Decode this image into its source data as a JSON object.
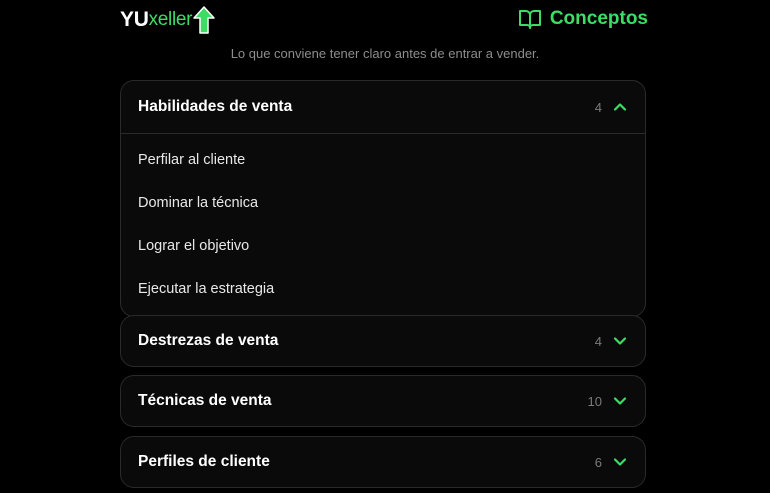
{
  "header": {
    "logo_yu": "YU",
    "logo_xeller": "xeller",
    "page_title": "Conceptos",
    "subtitle": "Lo que conviene tener claro antes de entrar a vender."
  },
  "sections": [
    {
      "title": "Habilidades de venta",
      "count": "4",
      "expanded": true,
      "items": [
        "Perfilar al cliente",
        "Dominar la técnica",
        "Lograr el objetivo",
        "Ejecutar la estrategia"
      ]
    },
    {
      "title": "Destrezas de venta",
      "count": "4",
      "expanded": false
    },
    {
      "title": "Técnicas de venta",
      "count": "10",
      "expanded": false
    },
    {
      "title": "Perfiles de cliente",
      "count": "6",
      "expanded": false
    }
  ],
  "colors": {
    "accent": "#3ddc63",
    "background": "#000000",
    "card": "#0a0a0a",
    "border": "#2a2a2a"
  }
}
